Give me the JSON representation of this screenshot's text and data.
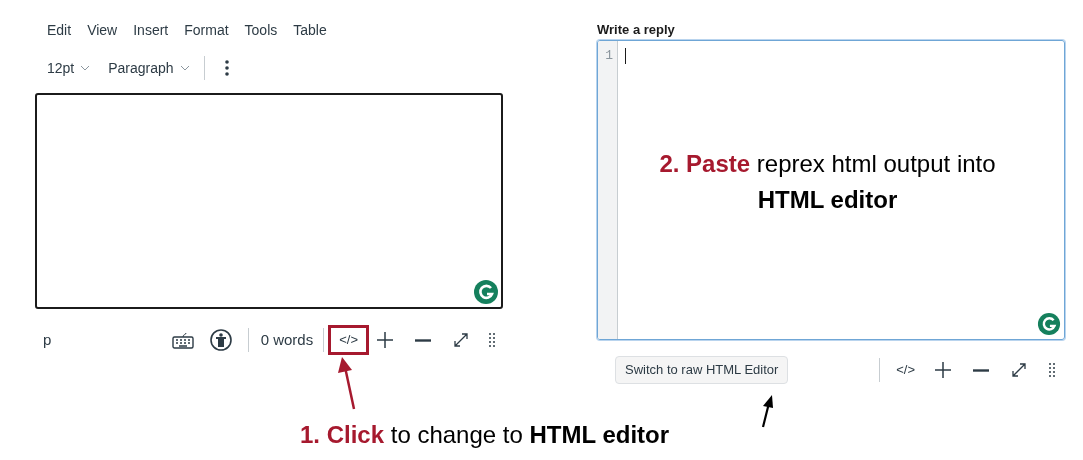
{
  "menu": [
    {
      "label": "Edit"
    },
    {
      "label": "View"
    },
    {
      "label": "Insert"
    },
    {
      "label": "Format"
    },
    {
      "label": "Tools"
    },
    {
      "label": "Table"
    }
  ],
  "toolbar": {
    "font_size": "12pt",
    "block_format": "Paragraph"
  },
  "left_status": {
    "element_path": "p",
    "word_count": "0 words",
    "code_button": "</>",
    "code_highlighted": true
  },
  "reply": {
    "title": "Write a reply",
    "line_number": "1",
    "focused": true,
    "switch_button": "Switch to raw HTML Editor",
    "code_button": "</>"
  },
  "annotations": [
    {
      "text": "**1. Click** to change to **HTML editor**"
    },
    {
      "text": "**2. Paste** reprex html output into **HTML editor**"
    }
  ]
}
